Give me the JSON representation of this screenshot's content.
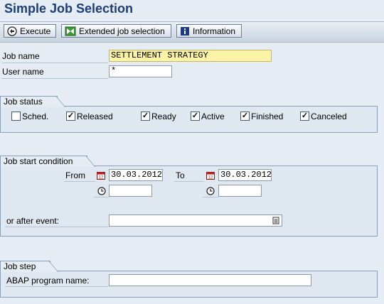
{
  "title": "Simple Job Selection",
  "toolbar": {
    "execute_label": "Execute",
    "extended_label": "Extended job selection",
    "information_label": "Information"
  },
  "fields": {
    "job_name_label": "Job name",
    "job_name_value": "SETTLEMENT STRATEGY",
    "user_name_label": "User name",
    "user_name_value": "*"
  },
  "job_status": {
    "title": "Job status",
    "items": [
      {
        "label": "Sched.",
        "checked": false
      },
      {
        "label": "Released",
        "checked": true
      },
      {
        "label": "Ready",
        "checked": true
      },
      {
        "label": "Active",
        "checked": true
      },
      {
        "label": "Finished",
        "checked": true
      },
      {
        "label": "Canceled",
        "checked": true
      }
    ]
  },
  "job_start": {
    "title": "Job start condition",
    "from_label": "From",
    "from_date": "30.03.2012",
    "to_label": "To",
    "to_date": "30.03.2012",
    "from_time": "",
    "to_time": "",
    "event_label": "or after event:",
    "event_value": ""
  },
  "job_step": {
    "title": "Job step",
    "program_label": "ABAP program name:",
    "program_value": ""
  },
  "colors": {
    "title": "#1c3e78",
    "background": "#e5ecf3",
    "required_field": "#fbf4a8"
  }
}
